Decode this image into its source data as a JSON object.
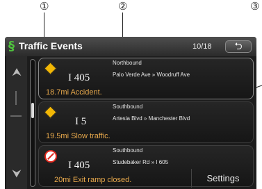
{
  "callouts": [
    "①",
    "②",
    "③"
  ],
  "header": {
    "title": "Traffic Events",
    "page_indicator": "10/18",
    "back_icon": "return-arrow-icon",
    "back_glyph": "⮌"
  },
  "scroll": {
    "up_glyph": "⮝",
    "down_glyph": "⮟"
  },
  "events": [
    {
      "icon": "warning-diamond-icon",
      "road": "I 405",
      "direction": "Northbound",
      "segment": "Palo Verde Ave » Woodruff Ave",
      "description": "18.7mi Accident."
    },
    {
      "icon": "warning-diamond-icon",
      "road": "I 5",
      "direction": "Southbound",
      "segment": "Artesia Blvd » Manchester Blvd",
      "description": "19.5mi Slow traffic."
    },
    {
      "icon": "no-entry-icon",
      "road": "I 405",
      "direction": "Southbound",
      "segment": "Studebaker Rd » I 605",
      "description": "20mi Exit ramp closed."
    }
  ],
  "footer": {
    "settings_label": "Settings"
  },
  "colors": {
    "accent_text": "#e8a94c",
    "title_icon": "#4fc23d",
    "warning": "#f2b705",
    "alert": "#e0261b"
  }
}
